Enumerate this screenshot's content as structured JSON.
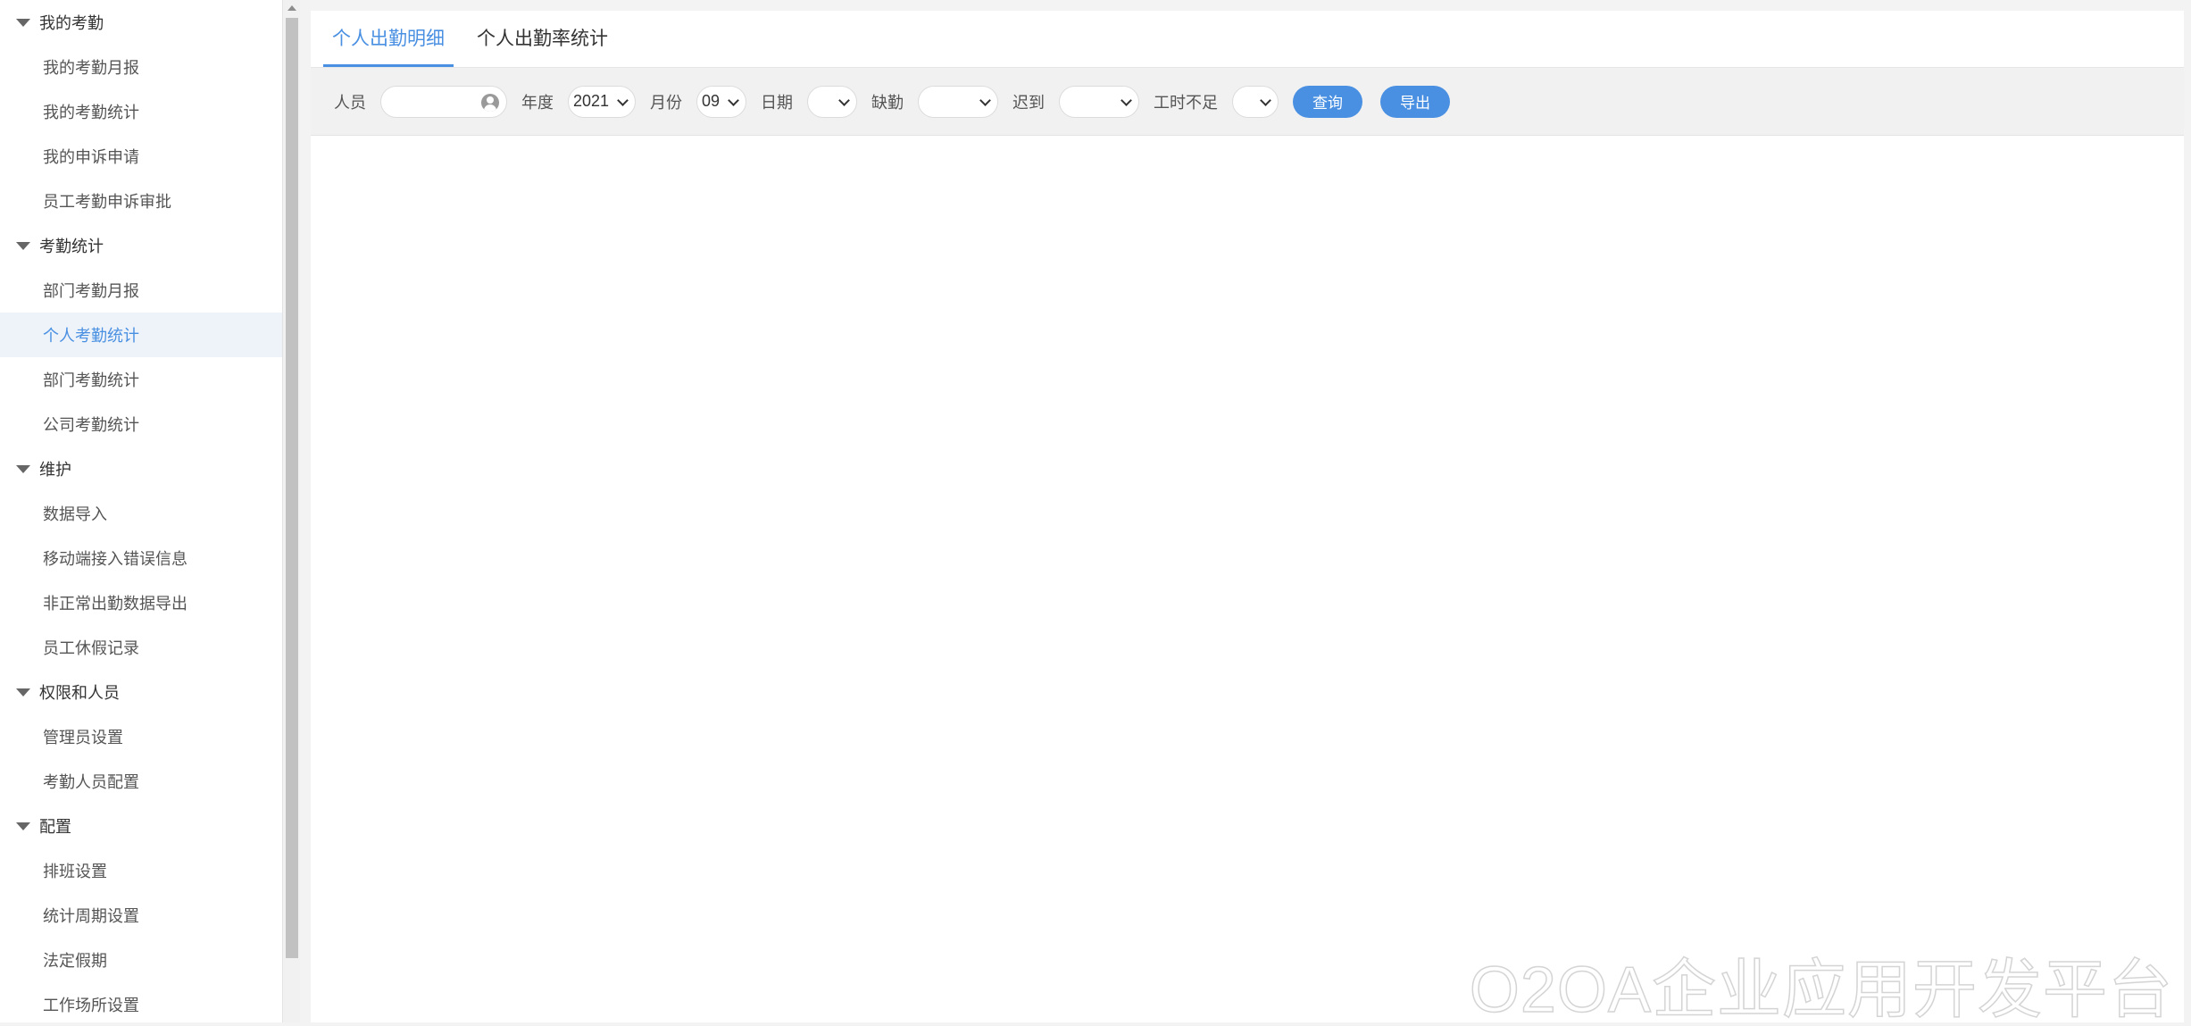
{
  "sidebar": {
    "groups": [
      {
        "label": "我的考勤",
        "items": [
          "我的考勤月报",
          "我的考勤统计",
          "我的申诉申请",
          "员工考勤申诉审批"
        ]
      },
      {
        "label": "考勤统计",
        "items": [
          "部门考勤月报",
          "个人考勤统计",
          "部门考勤统计",
          "公司考勤统计"
        ]
      },
      {
        "label": "维护",
        "items": [
          "数据导入",
          "移动端接入错误信息",
          "非正常出勤数据导出",
          "员工休假记录"
        ]
      },
      {
        "label": "权限和人员",
        "items": [
          "管理员设置",
          "考勤人员配置"
        ]
      },
      {
        "label": "配置",
        "items": [
          "排班设置",
          "统计周期设置",
          "法定假期",
          "工作场所设置"
        ]
      }
    ],
    "active_item": "个人考勤统计"
  },
  "tabs": [
    {
      "label": "个人出勤明细",
      "active": true
    },
    {
      "label": "个人出勤率统计",
      "active": false
    }
  ],
  "filters": {
    "person_label": "人员",
    "person_value": "",
    "year_label": "年度",
    "year_value": "2021",
    "month_label": "月份",
    "month_value": "09",
    "date_label": "日期",
    "date_value": "",
    "absent_label": "缺勤",
    "absent_value": "",
    "late_label": "迟到",
    "late_value": "",
    "hours_short_label": "工时不足",
    "hours_short_value": ""
  },
  "buttons": {
    "query": "查询",
    "export": "导出"
  },
  "watermark": "O2OA企业应用开发平台",
  "colors": {
    "accent": "#4a90e2",
    "active_item_bg": "#eef3f9"
  }
}
